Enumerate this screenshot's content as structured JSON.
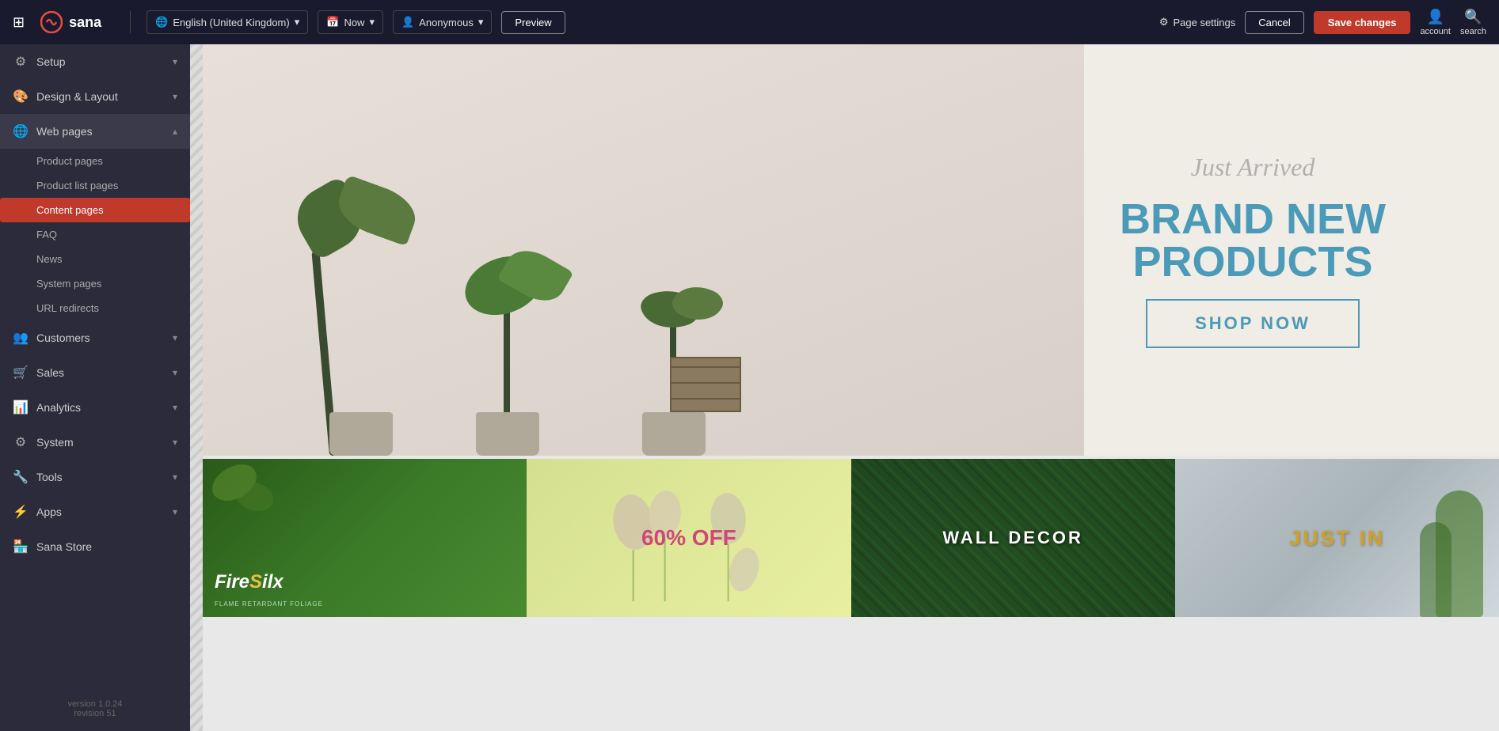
{
  "topbar": {
    "logo_text": "sana",
    "language_label": "English (United Kingdom)",
    "date_label": "Now",
    "user_label": "Anonymous",
    "preview_label": "Preview",
    "page_settings_label": "Page settings",
    "cancel_label": "Cancel",
    "save_label": "Save changes",
    "account_label": "account",
    "search_label": "search"
  },
  "sidebar": {
    "items": [
      {
        "id": "setup",
        "label": "Setup",
        "icon": "⚙",
        "expandable": true
      },
      {
        "id": "design-layout",
        "label": "Design & Layout",
        "icon": "🎨",
        "expandable": true
      },
      {
        "id": "web-pages",
        "label": "Web pages",
        "icon": "🌐",
        "expandable": true,
        "active": true
      },
      {
        "id": "customers",
        "label": "Customers",
        "icon": "👤",
        "expandable": true
      },
      {
        "id": "sales",
        "label": "Sales",
        "icon": "🛒",
        "expandable": true
      },
      {
        "id": "analytics",
        "label": "Analytics",
        "icon": "📊",
        "expandable": true
      },
      {
        "id": "system",
        "label": "System",
        "icon": "⚙",
        "expandable": true
      },
      {
        "id": "tools",
        "label": "Tools",
        "icon": "🔧",
        "expandable": true
      },
      {
        "id": "apps",
        "label": "Apps",
        "icon": "⚡",
        "expandable": true
      },
      {
        "id": "sana-store",
        "label": "Sana Store",
        "icon": "🏪",
        "expandable": false
      }
    ],
    "sub_items": [
      {
        "id": "product-pages",
        "label": "Product pages"
      },
      {
        "id": "product-list-pages",
        "label": "Product list pages"
      },
      {
        "id": "content-pages",
        "label": "Content pages",
        "active": true
      },
      {
        "id": "faq",
        "label": "FAQ"
      },
      {
        "id": "news",
        "label": "News"
      },
      {
        "id": "system-pages",
        "label": "System pages"
      },
      {
        "id": "url-redirects",
        "label": "URL redirects"
      }
    ],
    "version": "version 1.0.24",
    "revision": "revision 51"
  },
  "hero": {
    "just_arrived": "Just Arrived",
    "brand_new": "BRAND NEW PRODUCTS",
    "shop_now": "SHOP NOW"
  },
  "product_cards": [
    {
      "id": "firesilx",
      "label": "FireSilx",
      "sub_label": "FLAME RETARDANT FOLIAGE",
      "type": "brand"
    },
    {
      "id": "60off",
      "label": "60% OFF",
      "type": "promo"
    },
    {
      "id": "walldecor",
      "label": "WALL DECOR",
      "type": "category"
    },
    {
      "id": "justin",
      "label": "JUST IN",
      "type": "promo"
    }
  ]
}
